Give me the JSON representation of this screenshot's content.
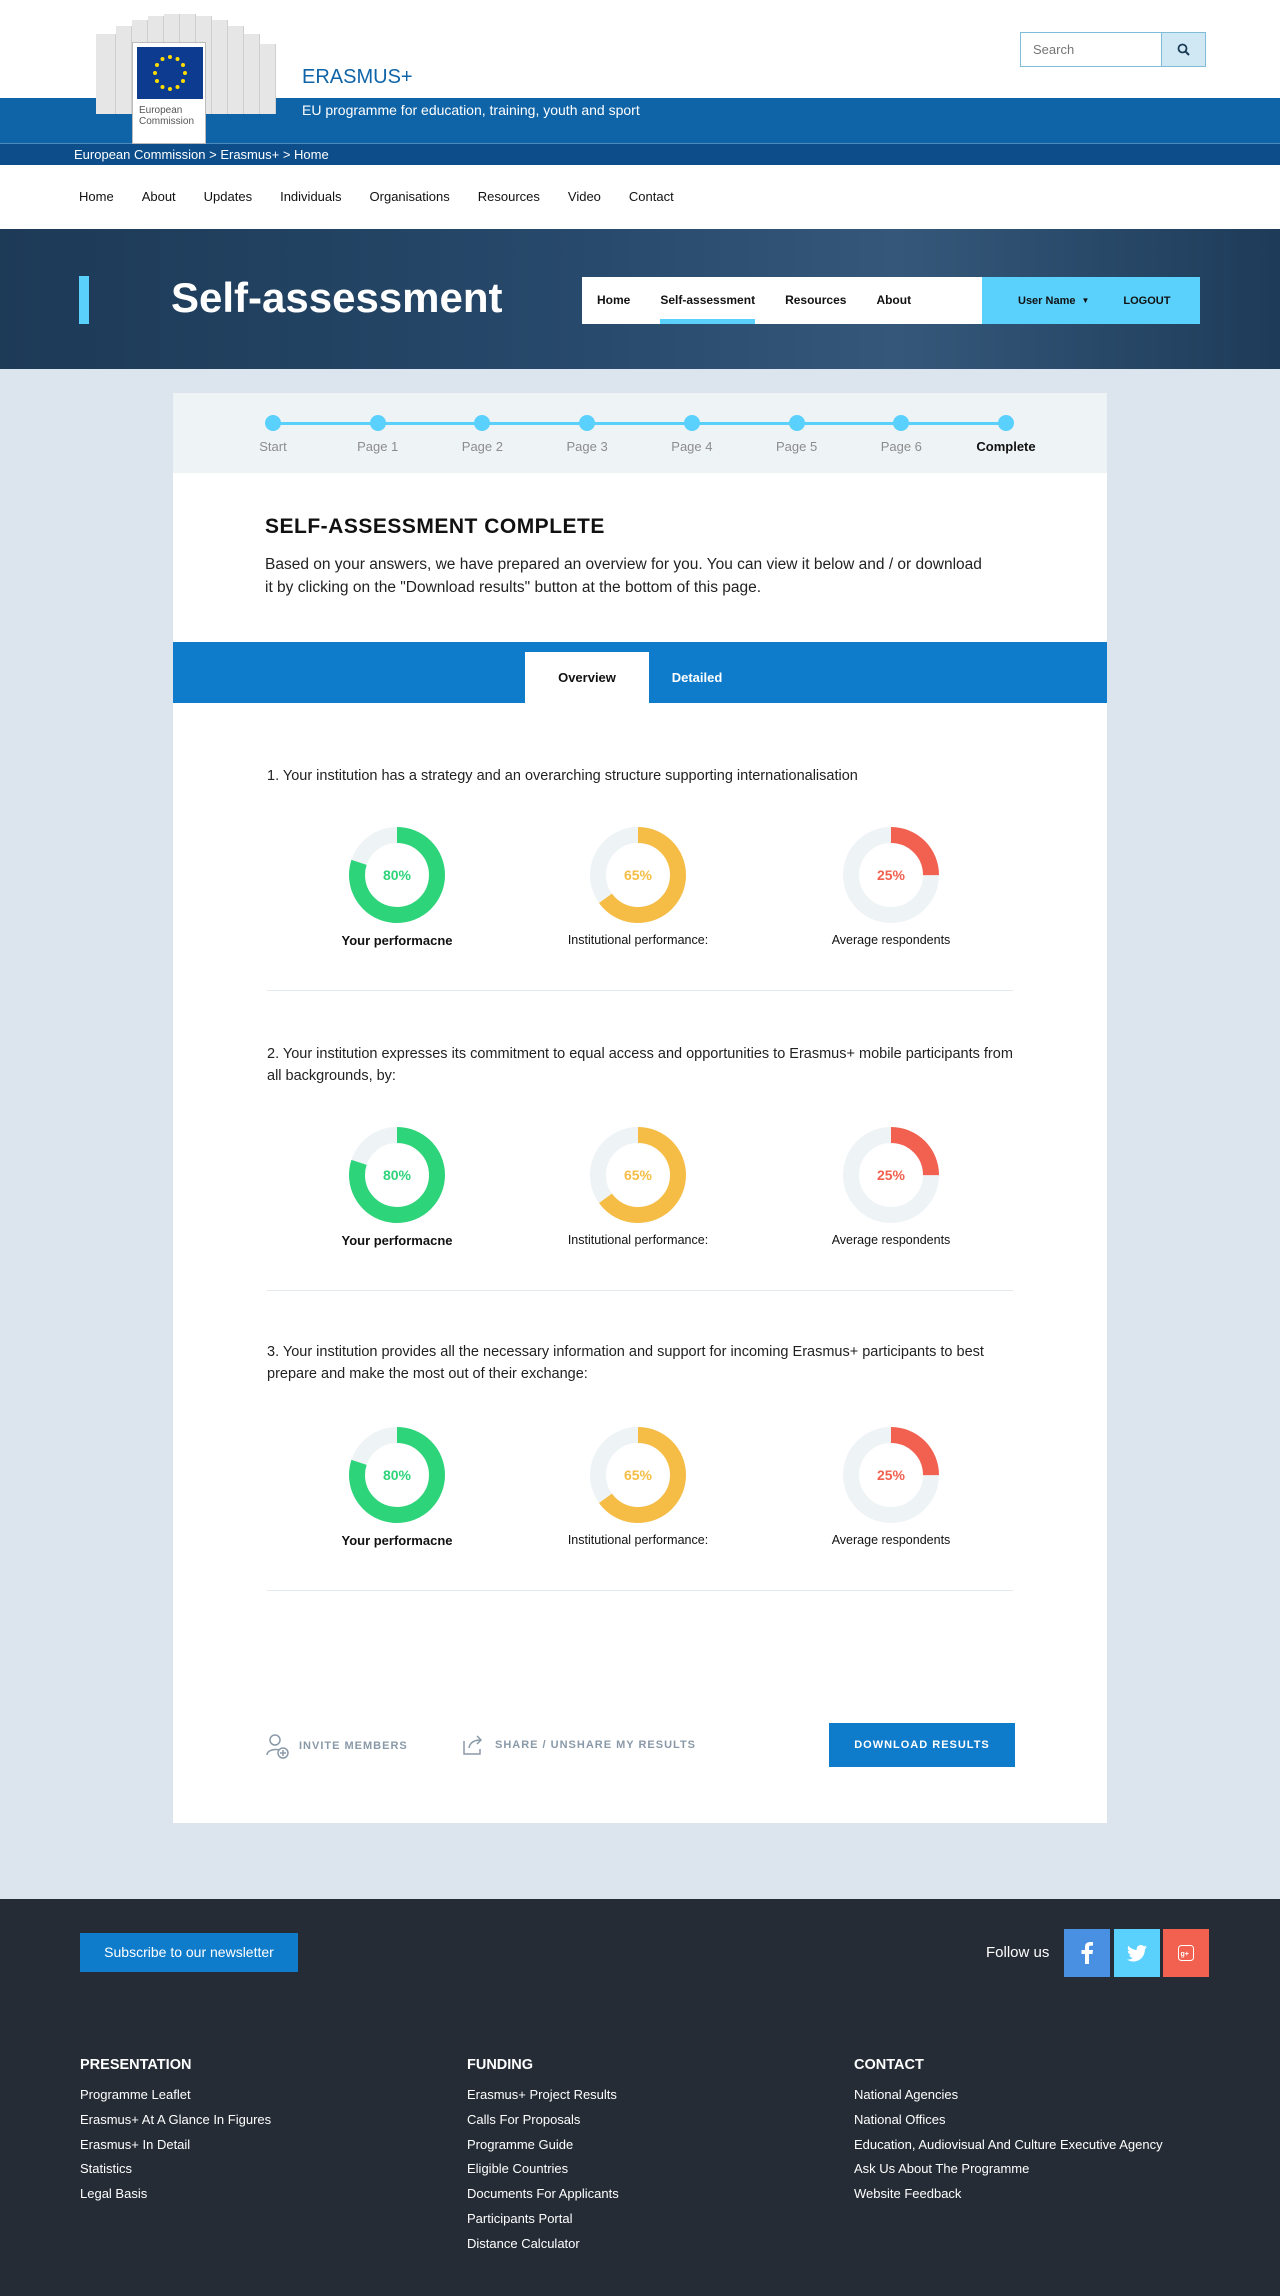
{
  "header": {
    "logo_text_line1": "European",
    "logo_text_line2": "Commission",
    "site_name": "ERASMUS+",
    "tagline": "EU programme for education, training, youth and sport",
    "breadcrumb": "European Commission > Erasmus+ > Home",
    "search_placeholder": "Search",
    "search_icon": "search-icon"
  },
  "main_nav": [
    "Home",
    "About",
    "Updates",
    "Individuals",
    "Organisations",
    "Resources",
    "Video",
    "Contact"
  ],
  "hero": {
    "title": "Self-assessment",
    "tabs": [
      "Home",
      "Self-assessment",
      "Resources",
      "About"
    ],
    "active_tab": "Self-assessment",
    "user_name": "User Name",
    "logout": "LOGOUT"
  },
  "stepper": {
    "steps": [
      "Start",
      "Page 1",
      "Page 2",
      "Page 3",
      "Page 4",
      "Page 5",
      "Page 6",
      "Complete"
    ],
    "current": "Complete"
  },
  "intro": {
    "title": "SELF-ASSESSMENT COMPLETE",
    "text": "Based on your answers, we have prepared an overview for you. You can view it below and / or download it by clicking on the \"Download results\" button at the bottom of this page."
  },
  "result_tabs": [
    "Overview",
    "Detailed"
  ],
  "questions": [
    {
      "text": "1. Your institution has a strategy and an overarching structure supporting internationalisation",
      "metrics": [
        {
          "label": "Your performacne",
          "value": 80,
          "display": "80%",
          "color": "#2ed47a"
        },
        {
          "label": "Institutional performance:",
          "value": 65,
          "display": "65%",
          "color": "#f5bd45"
        },
        {
          "label": "Average respondents",
          "value": 25,
          "display": "25%",
          "color": "#f2604f"
        }
      ]
    },
    {
      "text": "2. Your institution expresses its commitment to equal access and opportunities to Erasmus+ mobile participants from all backgrounds, by:",
      "metrics": [
        {
          "label": "Your performacne",
          "value": 80,
          "display": "80%",
          "color": "#2ed47a"
        },
        {
          "label": "Institutional performance:",
          "value": 65,
          "display": "65%",
          "color": "#f5bd45"
        },
        {
          "label": "Average respondents",
          "value": 25,
          "display": "25%",
          "color": "#f2604f"
        }
      ]
    },
    {
      "text": "3. Your institution provides all the necessary information and support for incoming Erasmus+ participants to best prepare and make the most out of their exchange:",
      "metrics": [
        {
          "label": "Your performacne",
          "value": 80,
          "display": "80%",
          "color": "#2ed47a"
        },
        {
          "label": "Institutional performance:",
          "value": 65,
          "display": "65%",
          "color": "#f5bd45"
        },
        {
          "label": "Average respondents",
          "value": 25,
          "display": "25%",
          "color": "#f2604f"
        }
      ]
    }
  ],
  "actions": {
    "invite": "INVITE MEMBERS",
    "share": "SHARE / UNSHARE MY RESULTS",
    "download": "DOWNLOAD RESULTS"
  },
  "footer": {
    "subscribe": "Subscribe to our newsletter",
    "follow": "Follow us",
    "social": [
      {
        "icon": "facebook-icon",
        "color": "#4a90e2"
      },
      {
        "icon": "twitter-icon",
        "color": "#5ad0fc"
      },
      {
        "icon": "google-plus-icon",
        "color": "#f2604f"
      }
    ],
    "columns": [
      {
        "title": "PRESENTATION",
        "links": [
          "Programme Leaflet",
          "Erasmus+ At A Glance In Figures",
          "Erasmus+ In Detail",
          "Statistics",
          "Legal Basis"
        ]
      },
      {
        "title": "FUNDING",
        "links": [
          "Erasmus+ Project Results",
          "Calls For Proposals",
          "Programme Guide",
          "Eligible Countries",
          "Documents For Applicants",
          "Participants Portal",
          "Distance Calculator"
        ]
      },
      {
        "title": "CONTACT",
        "links": [
          "National Agencies",
          "National Offices",
          "Education, Audiovisual And Culture Executive Agency",
          "Ask Us About The Programme",
          "Website Feedback"
        ]
      }
    ]
  },
  "colors": {
    "brand_blue": "#0f64a8",
    "accent_blue": "#0f7ccb",
    "light_accent": "#5ad0fc",
    "footer_bg": "#252c35"
  }
}
